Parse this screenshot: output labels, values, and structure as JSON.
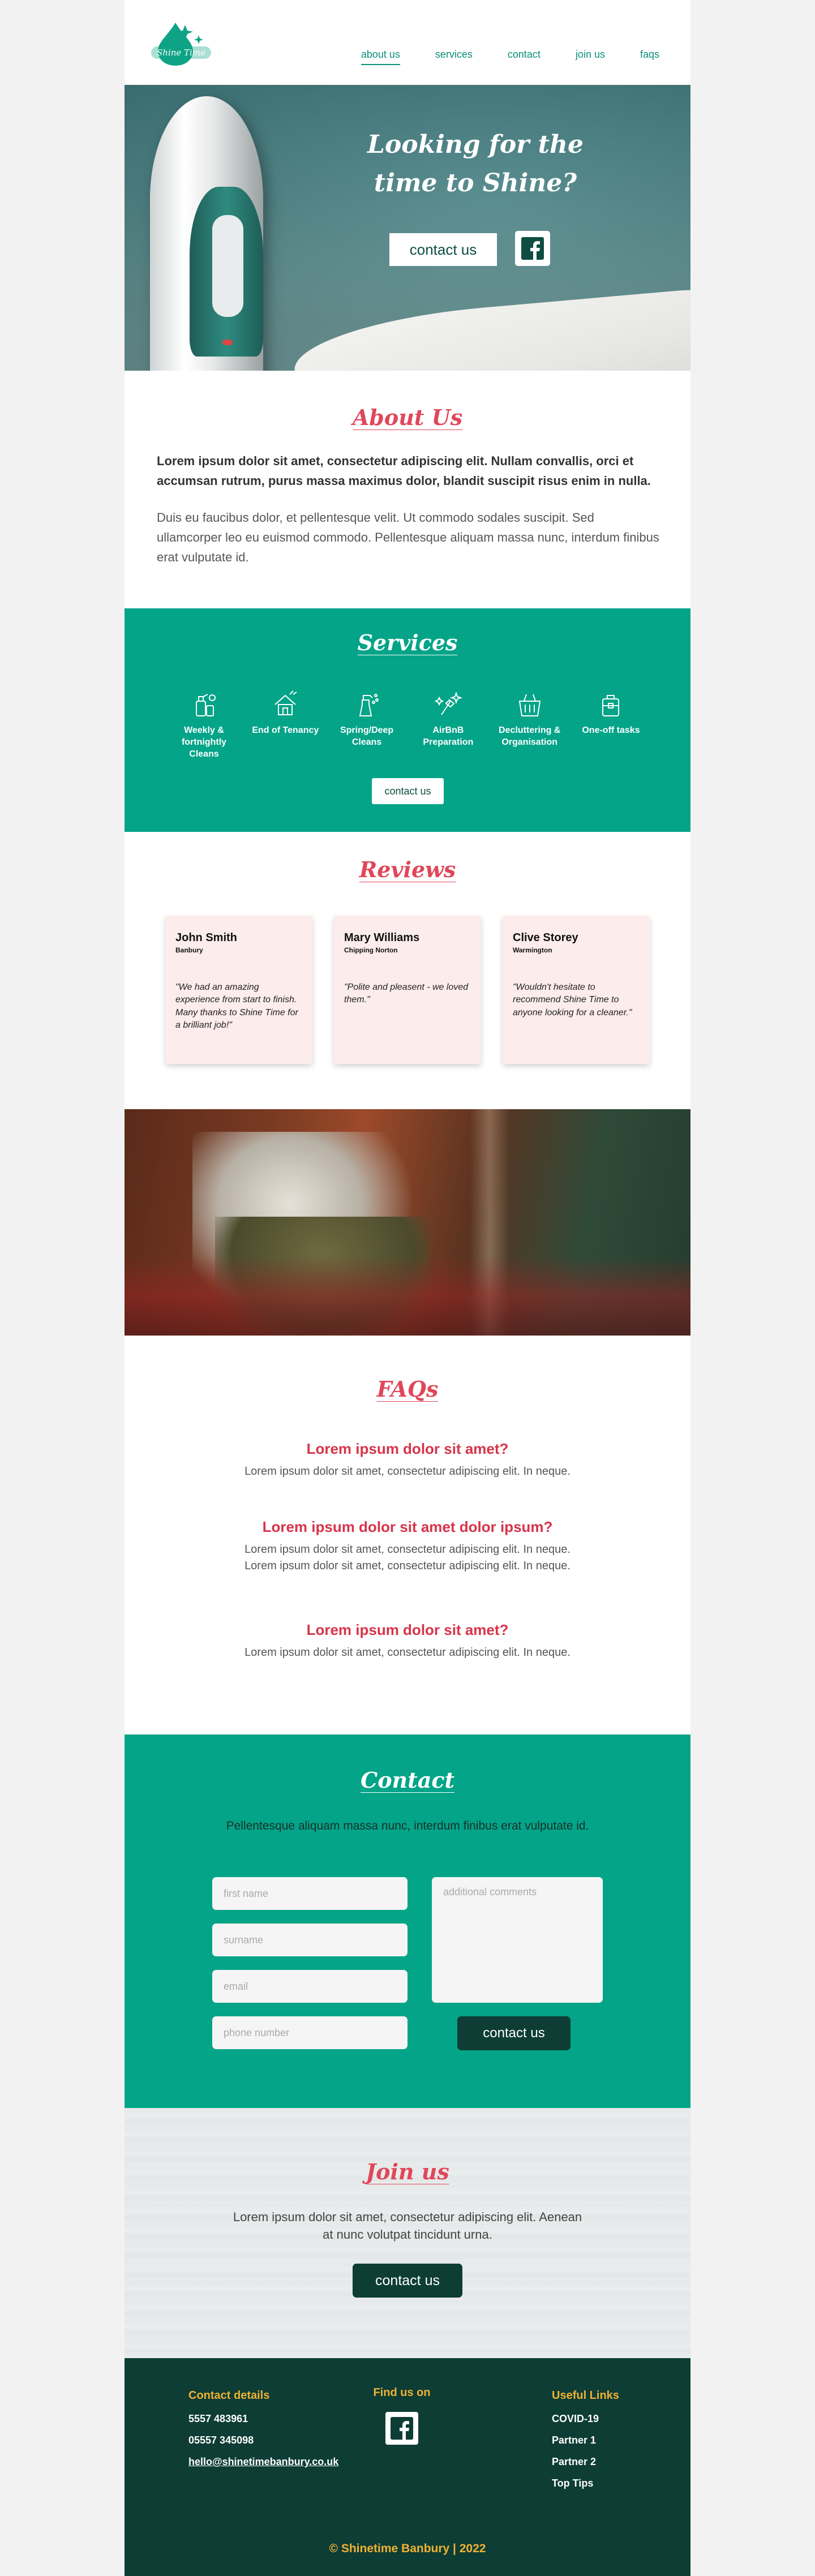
{
  "header": {
    "logo_alt": "Shine Time",
    "nav": [
      {
        "label": "about us",
        "active": true
      },
      {
        "label": "services",
        "active": false
      },
      {
        "label": "contact",
        "active": false
      },
      {
        "label": "join us",
        "active": false
      },
      {
        "label": "faqs",
        "active": false
      }
    ]
  },
  "hero": {
    "heading": "Looking for the time to Shine?",
    "button_label": "contact us",
    "social_icon": "facebook-icon"
  },
  "about": {
    "title": "About Us",
    "lead": "Lorem ipsum dolor sit amet, consectetur adipiscing elit. Nullam convallis, orci et accumsan rutrum, purus massa maximus dolor, blandit suscipit risus enim in nulla.",
    "body": "Duis eu faucibus dolor, et pellentesque velit. Ut commodo sodales suscipit. Sed ullamcorper leo eu euismod commodo. Pellentesque aliquam massa nunc, interdum finibus erat vulputate id."
  },
  "services": {
    "title": "Services",
    "items": [
      {
        "label": "Weekly & fortnightly Cleans",
        "icon": "cleaning-supplies-icon"
      },
      {
        "label": "End of Tenancy",
        "icon": "house-cleaning-icon"
      },
      {
        "label": "Spring/Deep Cleans",
        "icon": "spray-bottle-icon"
      },
      {
        "label": "AirBnB Preparation",
        "icon": "sparkle-brush-icon"
      },
      {
        "label": "Decluttering & Organisation",
        "icon": "storage-basket-icon"
      },
      {
        "label": "One-off tasks",
        "icon": "toolbox-icon"
      }
    ],
    "button_label": "contact us"
  },
  "reviews": {
    "title": "Reviews",
    "items": [
      {
        "name": "John Smith",
        "place": "Banbury",
        "text": "\"We had an amazing experience from start to finish. Many thanks to Shine Time for a brilliant job!\""
      },
      {
        "name": "Mary Williams",
        "place": "Chipping Norton",
        "text": "\"Polite and pleasent - we loved them.\""
      },
      {
        "name": "Clive Storey",
        "place": "Warmington",
        "text": "\"Wouldn't hesitate to recommend Shine Time to anyone looking for a cleaner.\""
      }
    ]
  },
  "faqs": {
    "title": "FAQs",
    "items": [
      {
        "q": "Lorem ipsum dolor sit amet?",
        "a": "Lorem ipsum dolor sit amet, consectetur adipiscing elit. In neque."
      },
      {
        "q": "Lorem ipsum dolor sit amet dolor ipsum?",
        "a": "Lorem ipsum dolor sit amet, consectetur adipiscing elit. In neque. Lorem ipsum dolor sit amet, consectetur adipiscing elit. In neque."
      },
      {
        "q": "Lorem ipsum dolor sit amet?",
        "a": "Lorem ipsum dolor sit amet, consectetur adipiscing elit. In neque."
      }
    ]
  },
  "contact": {
    "title": "Contact",
    "subtitle": "Pellentesque aliquam massa nunc, interdum finibus erat vulputate id.",
    "fields": {
      "first_name": "first name",
      "surname": "surname",
      "email": "email",
      "phone": "phone number",
      "comments": "additional comments"
    },
    "button_label": "contact us"
  },
  "join": {
    "title": "Join us",
    "text": "Lorem ipsum dolor sit amet, consectetur adipiscing elit. Aenean at nunc volutpat tincidunt urna.",
    "button_label": "contact us"
  },
  "footer": {
    "contact_heading": "Contact details",
    "phone1": "5557 483961",
    "phone2": "05557 345098",
    "email": "hello@shinetimebanbury.co.uk",
    "find_heading": "Find us on",
    "links_heading": "Useful Links",
    "links": [
      "COVID-19",
      "Partner 1",
      "Partner 2",
      "Top Tips"
    ],
    "copyright": "© Shinetime Banbury | 2022"
  },
  "colors": {
    "teal": "#03a488",
    "dark_green": "#0d3d34",
    "pink_heading": "#e0475a",
    "gold": "#f0b233"
  }
}
